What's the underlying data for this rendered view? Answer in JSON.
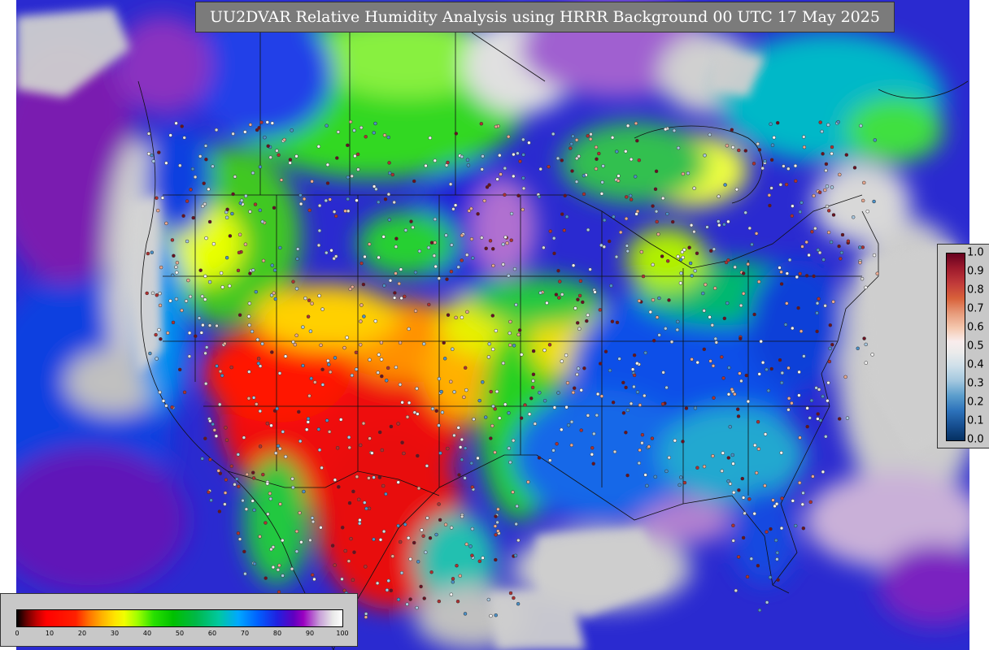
{
  "title": "UU2DVAR Relative Humidity Analysis using HRRR Background 00 UTC 17 May 2025",
  "humidity_legend": {
    "ticks": [
      "0",
      "10",
      "20",
      "30",
      "40",
      "50",
      "60",
      "70",
      "80",
      "90",
      "100"
    ]
  },
  "ratio_legend": {
    "ticks": [
      "1.0",
      "0.9",
      "0.8",
      "0.7",
      "0.6",
      "0.5",
      "0.4",
      "0.3",
      "0.2",
      "0.1",
      "0.0"
    ]
  },
  "colors": {
    "ocean_moist": "#2828d8",
    "very_moist": "#c8c8c8",
    "dry": "#ee1010",
    "moderate": "#20d000",
    "humid": "#0070e8"
  }
}
